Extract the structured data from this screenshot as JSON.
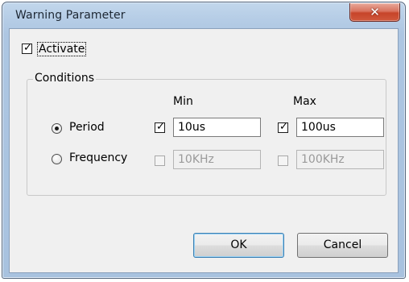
{
  "window": {
    "title": "Warning Parameter",
    "close_symbol": "✕"
  },
  "activate": {
    "label": "Activate",
    "checked": true
  },
  "conditions": {
    "title": "Conditions",
    "min_header": "Min",
    "max_header": "Max",
    "rows": [
      {
        "label": "Period",
        "selected": true,
        "min_checked": true,
        "min_value": "10us",
        "max_checked": true,
        "max_value": "100us",
        "enabled": true
      },
      {
        "label": "Frequency",
        "selected": false,
        "min_checked": false,
        "min_value": "10KHz",
        "max_checked": false,
        "max_value": "100KHz",
        "enabled": false
      }
    ]
  },
  "buttons": {
    "ok": "OK",
    "cancel": "Cancel"
  },
  "check_mark": "✓"
}
